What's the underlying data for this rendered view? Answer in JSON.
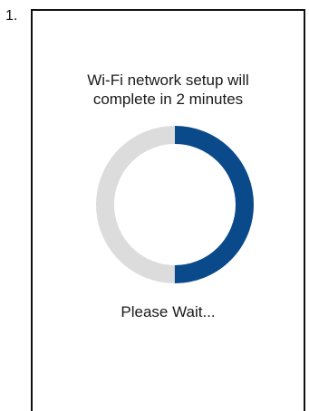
{
  "step": {
    "number": "1."
  },
  "setup": {
    "message_line1": "Wi-Fi network setup will",
    "message_line2": "complete in 2 minutes",
    "wait_label": "Please Wait..."
  },
  "progress": {
    "fraction": 0.5,
    "track_color": "#dcdcdc",
    "fill_color": "#0a4a8a"
  }
}
